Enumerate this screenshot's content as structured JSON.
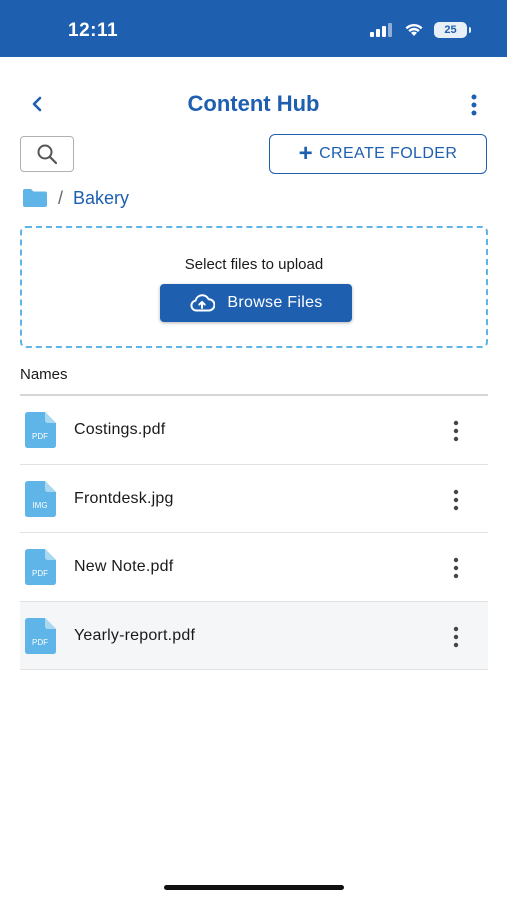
{
  "status_bar": {
    "time": "12:11",
    "battery_level": "25",
    "icons": [
      "signal-icon",
      "wifi-icon",
      "battery-icon"
    ]
  },
  "header": {
    "title": "Content Hub",
    "back_icon": "chevron-left-icon",
    "menu_icon": "more-vertical-icon"
  },
  "toolbar": {
    "search_icon": "search-icon",
    "create_folder_label": "CREATE FOLDER"
  },
  "breadcrumb": {
    "root_icon": "folder-icon",
    "separator": "/",
    "current": "Bakery"
  },
  "upload": {
    "prompt": "Select files to upload",
    "browse_label": "Browse Files",
    "browse_icon": "cloud-upload-icon"
  },
  "file_list": {
    "column_header": "Names",
    "items": [
      {
        "name": "Costings.pdf",
        "type_label": "PDF"
      },
      {
        "name": "Frontdesk.jpg",
        "type_label": "IMG"
      },
      {
        "name": "New Note.pdf",
        "type_label": "PDF"
      },
      {
        "name": "Yearly-report.pdf",
        "type_label": "PDF"
      }
    ]
  },
  "colors": {
    "brand": "#1e5fb0",
    "accent_light": "#5fb4e8",
    "file_icon": "#5fb4e8"
  }
}
